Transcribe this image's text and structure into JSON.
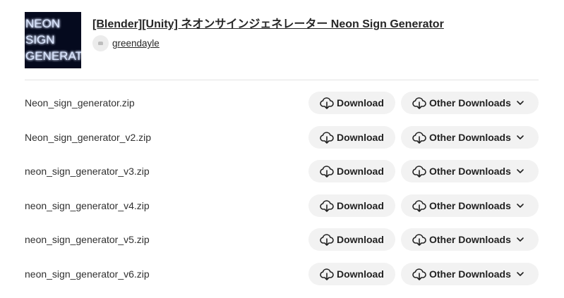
{
  "header": {
    "thumbnail_text": [
      "NEON",
      "SIGN",
      "GENERATOR"
    ],
    "title": "[Blender][Unity] ネオンサインジェネレーター Neon Sign Generator",
    "author": "greendayle"
  },
  "files": [
    {
      "name": "Neon_sign_generator.zip",
      "download_label": "Download",
      "other_label": "Other Downloads"
    },
    {
      "name": "Neon_sign_generator_v2.zip",
      "download_label": "Download",
      "other_label": "Other Downloads"
    },
    {
      "name": "neon_sign_generator_v3.zip",
      "download_label": "Download",
      "other_label": "Other Downloads"
    },
    {
      "name": "neon_sign_generator_v4.zip",
      "download_label": "Download",
      "other_label": "Other Downloads"
    },
    {
      "name": "neon_sign_generator_v5.zip",
      "download_label": "Download",
      "other_label": "Other Downloads"
    },
    {
      "name": "neon_sign_generator_v6.zip",
      "download_label": "Download",
      "other_label": "Other Downloads"
    }
  ],
  "icons": {
    "download": "cloud-download-icon",
    "dropdown": "chevron-down-icon",
    "avatar": "user-avatar"
  },
  "colors": {
    "button_bg": "#f2f2f2",
    "thumbnail_bg": "#050a1e",
    "neon_text": "#dbe6ff"
  }
}
